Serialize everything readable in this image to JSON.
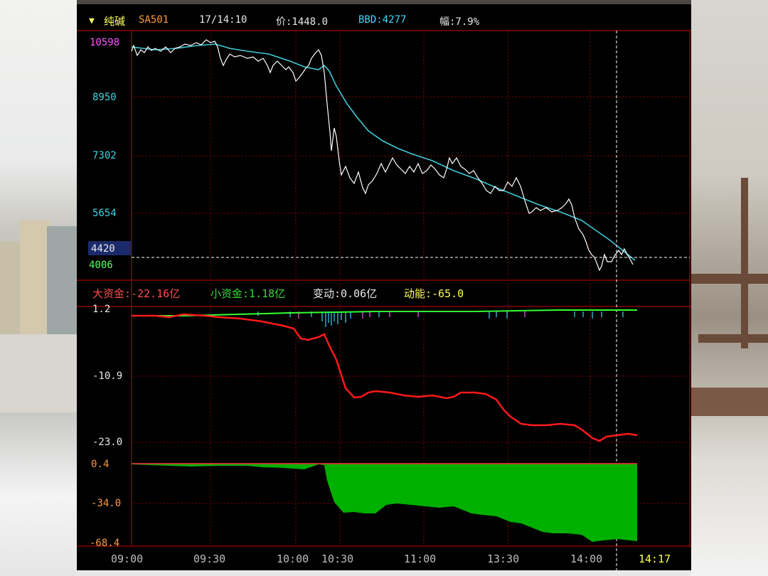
{
  "header": {
    "dropdown_icon": "triangle-down-icon",
    "name": "纯碱",
    "code": "SA501",
    "date_time": "17/14:10",
    "price": "价:1448.0",
    "bbd": "BBD:4277",
    "amplitude": "幅:7.9%",
    "colors": {
      "name": "#ffff55",
      "code": "#ff9a3c",
      "bbd": "#40d8ff",
      "text": "#e8e8e8"
    }
  },
  "price_panel": {
    "y_labels": [
      "10598",
      "8950",
      "7302",
      "5654",
      "4420",
      "4006"
    ],
    "cursor_value": "4420",
    "colors": {
      "price_line": "#ffffff",
      "avg_line": "#3fc9d6",
      "grid": "#8b0000",
      "top_label": "#ff55ff",
      "label": "#3fd4e0",
      "low_label": "#55ff55"
    }
  },
  "legend": {
    "large_funds": "大资金:-22.16亿",
    "small_funds": "小资金:1.18亿",
    "change": "变动:0.06亿",
    "momentum": "动能:-65.0",
    "colors": {
      "large": "#ff4d4d",
      "small": "#33dd33",
      "change": "#e8e8e8",
      "momentum": "#ffff55"
    }
  },
  "flow_panel": {
    "y_labels": [
      "1.2",
      "-10.9",
      "-23.0"
    ],
    "colors": {
      "large_line": "#ff1a1a",
      "small_line": "#33ff33"
    }
  },
  "area_panel": {
    "y_labels": [
      "0.4",
      "-34.0",
      "-68.4"
    ],
    "colors": {
      "fill": "#00b000",
      "zero_line": "#ff3333"
    }
  },
  "x_axis": {
    "labels": [
      "09:00",
      "09:30",
      "10:00",
      "10:30",
      "11:00",
      "13:30",
      "14:00"
    ],
    "cursor_time": "14:17"
  }
}
